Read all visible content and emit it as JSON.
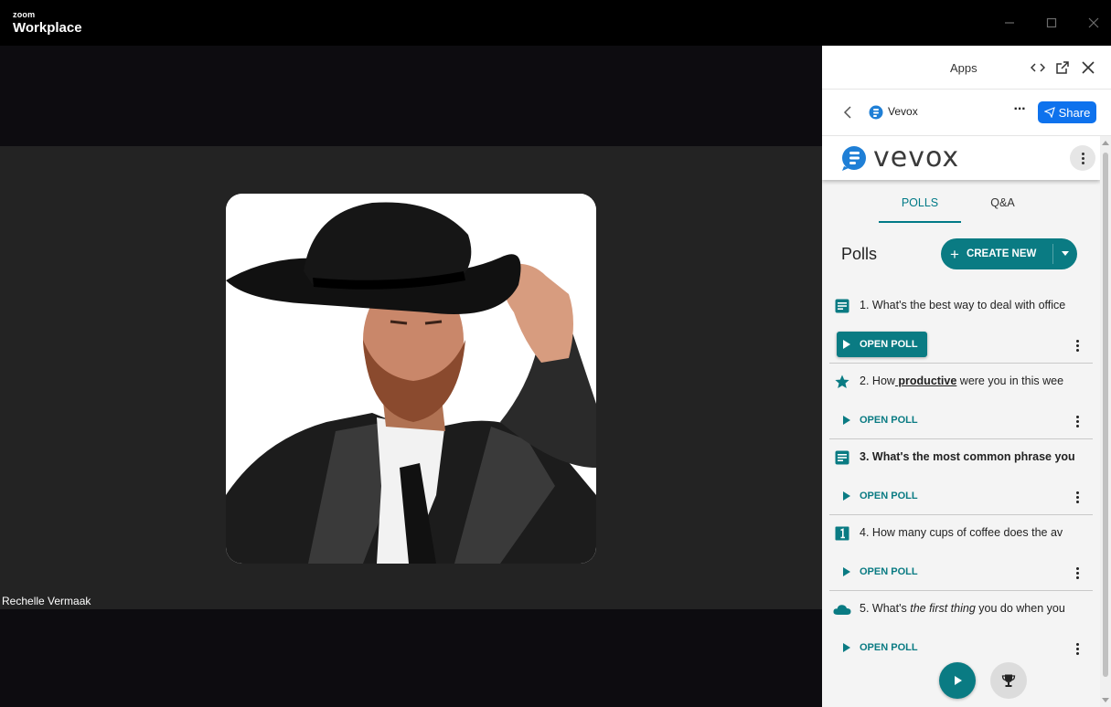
{
  "titlebar": {
    "brand_small": "zoom",
    "brand_big": "Workplace"
  },
  "video": {
    "participant_name": "Rechelle Vermaak"
  },
  "panel": {
    "title": "Apps",
    "app_name": "Vevox",
    "share_label": "Share"
  },
  "vevox": {
    "wordmark": "vevox",
    "tabs": [
      "POLLS",
      "Q&A"
    ],
    "polls_heading": "Polls",
    "create_label": "CREATE NEW",
    "open_label": "OPEN POLL",
    "polls": [
      {
        "icon": "text-poll-icon",
        "number": "1.",
        "question": "What's the best way to deal with office"
      },
      {
        "icon": "star-rating-icon",
        "number": "2.",
        "pre": "How",
        "underlined": " productive",
        "post": " were you in this wee"
      },
      {
        "icon": "text-poll-icon",
        "number": "3.",
        "question": "What's the most common phrase you"
      },
      {
        "icon": "numeric-poll-icon",
        "number": "4.",
        "question": "How many cups of coffee does the av"
      },
      {
        "icon": "word-cloud-icon",
        "number": "5.",
        "pre": "What's ",
        "italic": "the first thing",
        "post": " you do when you"
      }
    ]
  },
  "colors": {
    "teal": "#0a7b83",
    "zoom_blue": "#0e72ed",
    "tile_bg": "#232323"
  }
}
